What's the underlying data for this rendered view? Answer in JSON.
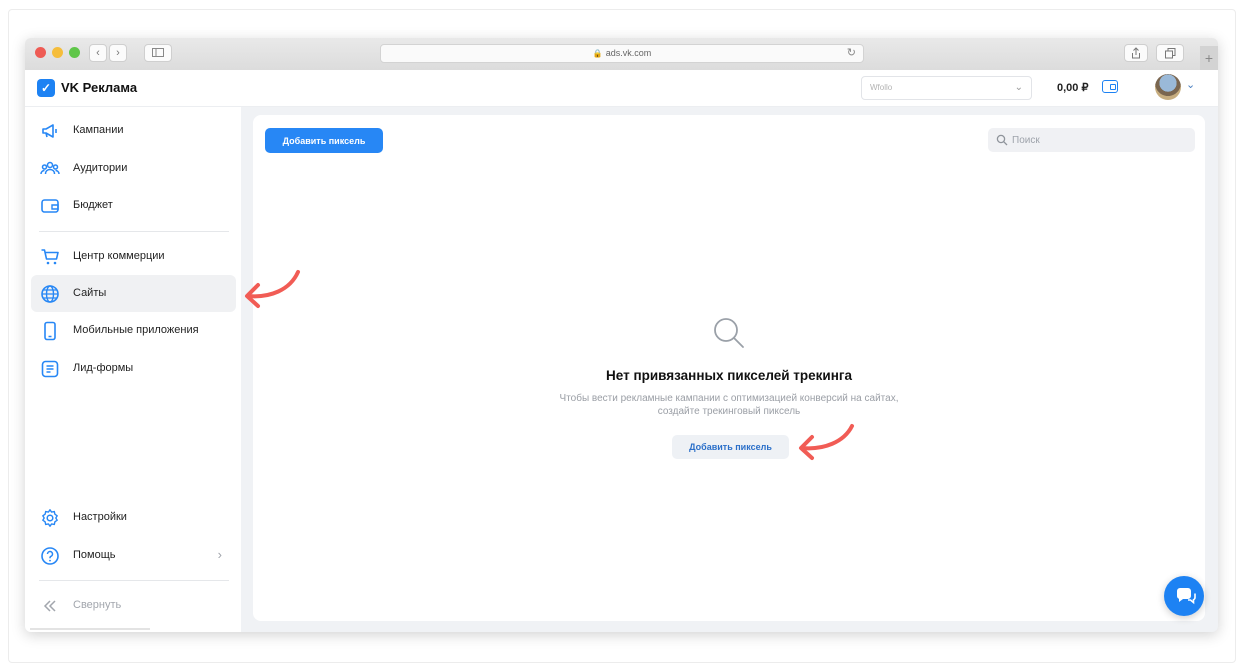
{
  "browser": {
    "url": "ads.vk.com"
  },
  "header": {
    "app_name": "VK Реклама",
    "account_placeholder": "Wfollo",
    "balance": "0,00 ₽"
  },
  "sidebar": {
    "items": [
      {
        "label": "Кампании",
        "icon": "megaphone-icon"
      },
      {
        "label": "Аудитории",
        "icon": "audience-icon"
      },
      {
        "label": "Бюджет",
        "icon": "wallet-icon"
      },
      {
        "label": "Центр коммерции",
        "icon": "cart-icon"
      },
      {
        "label": "Сайты",
        "icon": "globe-icon",
        "active": true
      },
      {
        "label": "Мобильные приложения",
        "icon": "smartphone-icon"
      },
      {
        "label": "Лид-формы",
        "icon": "form-icon"
      }
    ],
    "bottom": [
      {
        "label": "Настройки",
        "icon": "gear-icon"
      },
      {
        "label": "Помощь",
        "icon": "help-icon"
      },
      {
        "label": "Свернуть",
        "icon": "collapse-icon"
      }
    ]
  },
  "main": {
    "add_pixel_label": "Добавить пиксель",
    "search_placeholder": "Поиск",
    "empty_title": "Нет привязанных пикселей трекинга",
    "empty_description": "Чтобы вести рекламные кампании с оптимизацией конверсий на сайтах, создайте трекинговый пиксель",
    "empty_button_label": "Добавить пиксель"
  },
  "colors": {
    "accent": "#2787f5",
    "annotation_arrow": "#f15c55"
  }
}
